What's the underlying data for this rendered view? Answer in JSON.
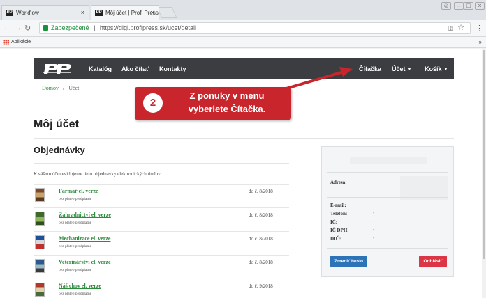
{
  "browser": {
    "tabs": [
      {
        "favicon": "PP",
        "title": "Workflow",
        "close": "×"
      },
      {
        "favicon": "PP",
        "title": "Môj účet | Profi Press s.r.o.",
        "close": "×"
      }
    ],
    "omnibox": {
      "secure_label": "Zabezpečené",
      "separator": "|",
      "url": "https://digi.profipress.sk/ucet/detail"
    },
    "bookmarks": {
      "apps_label": "Aplikácie",
      "more": "»"
    }
  },
  "site": {
    "menu": {
      "katalog": "Katalóg",
      "ako_citat": "Ako čítať",
      "kontakty": "Kontakty",
      "citacka": "Čítačka",
      "ucet": "Účet",
      "kosik": "Košík",
      "caret": "▼"
    },
    "breadcrumb": {
      "home": "Domov",
      "separator": "/",
      "current": "Účet"
    },
    "page_title": "Môj účet",
    "orders_heading": "Objednávky",
    "orders_intro": "K vášmu účtu evidujeme tieto objednávky elektronických titulov:",
    "orders": [
      {
        "title": "Farmář el. verze",
        "sub": "bez plateb predplatné",
        "upto": "do č. 8/2018"
      },
      {
        "title": "Zahradnictví el. verze",
        "sub": "bez plateb predplatné",
        "upto": "do č. 8/2018"
      },
      {
        "title": "Mechanizace el. verze",
        "sub": "bez plateb predplatné",
        "upto": "do č. 8/2018"
      },
      {
        "title": "Veterinářství el. verze",
        "sub": "bez plateb predplatné",
        "upto": "do č. 8/2018"
      },
      {
        "title": "Náš chov el. verze",
        "sub": "bez plateb predplatné",
        "upto": "do č. 9/2018"
      }
    ],
    "account": {
      "adresa_label": "Adresa:",
      "email_label": "E-mail:",
      "telefon_label": "Telefón:",
      "telefon_value": "-",
      "ico_label": "IČ:",
      "ico_value": "-",
      "icdph_label": "IČ DPH:",
      "icdph_value": "-",
      "dic_label": "DIČ:",
      "dic_value": "-",
      "change_password": "Zmeniť heslo",
      "logout": "Odhlásiť"
    }
  },
  "annotation": {
    "number": "2",
    "line1": "Z ponuky v menu",
    "line2": "vyberiete Čítačka."
  },
  "colors": {
    "navbar": "#3b3d40",
    "link_green": "#2e8b3e",
    "callout_red": "#c8252c",
    "button_blue": "#2d73b8",
    "button_red": "#dc3545"
  }
}
